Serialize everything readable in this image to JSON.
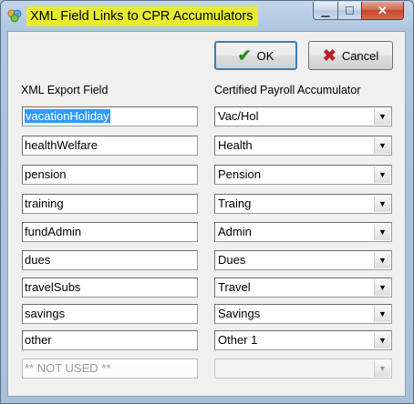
{
  "window": {
    "title": "XML Field Links to CPR Accumulators",
    "min_glyph": "▁",
    "max_glyph": "☐",
    "close_glyph": "✕"
  },
  "buttons": {
    "ok_label": "OK",
    "ok_icon": "check-icon",
    "cancel_label": "Cancel",
    "cancel_icon": "x-icon"
  },
  "headers": {
    "left": "XML Export Field",
    "right": "Certified Payroll Accumulator"
  },
  "rows": [
    {
      "field": "vacationHoliday",
      "accumulator": "Vac/Hol",
      "selected": true
    },
    {
      "field": "healthWelfare",
      "accumulator": "Health"
    },
    {
      "field": "pension",
      "accumulator": "Pension"
    },
    {
      "field": "training",
      "accumulator": "Traing"
    },
    {
      "field": "fundAdmin",
      "accumulator": "Admin"
    },
    {
      "field": "dues",
      "accumulator": "Dues"
    },
    {
      "field": "travelSubs",
      "accumulator": "Travel"
    },
    {
      "field": "savings",
      "accumulator": "Savings"
    },
    {
      "field": "other",
      "accumulator": "Other 1"
    },
    {
      "field": "** NOT USED **",
      "accumulator": "",
      "disabled": true
    }
  ],
  "colors": {
    "title_highlight": "#e8ec2e",
    "selection": "#3399ff"
  }
}
